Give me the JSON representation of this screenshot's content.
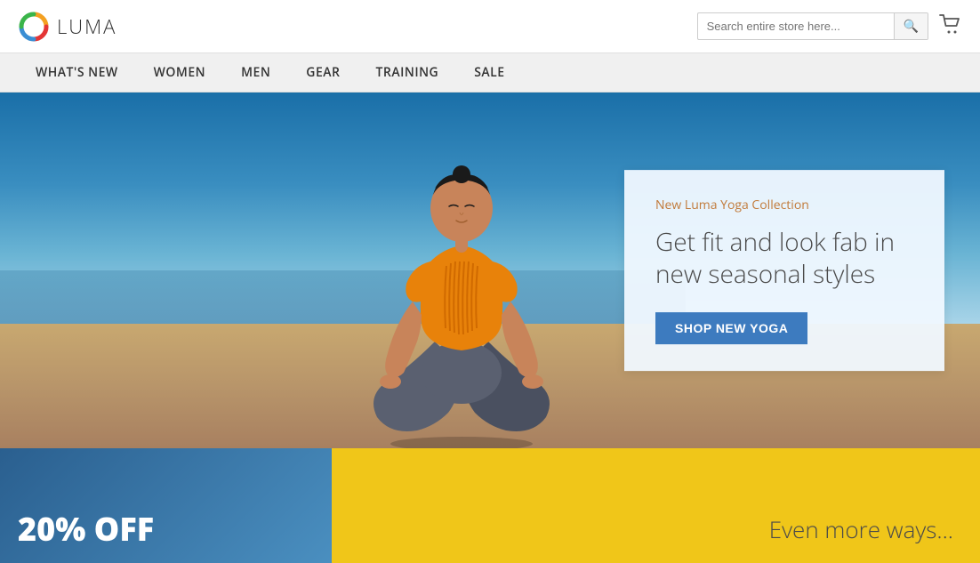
{
  "header": {
    "logo_text": "LUMA",
    "search_placeholder": "Search entire store here...",
    "search_button_label": "🔍",
    "cart_icon": "🛒"
  },
  "nav": {
    "items": [
      {
        "label": "What's New",
        "id": "whats-new"
      },
      {
        "label": "Women",
        "id": "women"
      },
      {
        "label": "Men",
        "id": "men"
      },
      {
        "label": "Gear",
        "id": "gear"
      },
      {
        "label": "Training",
        "id": "training"
      },
      {
        "label": "Sale",
        "id": "sale"
      }
    ]
  },
  "hero": {
    "promo_subtitle": "New Luma Yoga Collection",
    "promo_title": "Get fit and look fab in new seasonal styles",
    "shop_button_label": "Shop New Yoga"
  },
  "bottom_left_banner": {
    "text": "20% OFF"
  },
  "bottom_right_banner": {
    "text": "Even more ways..."
  }
}
